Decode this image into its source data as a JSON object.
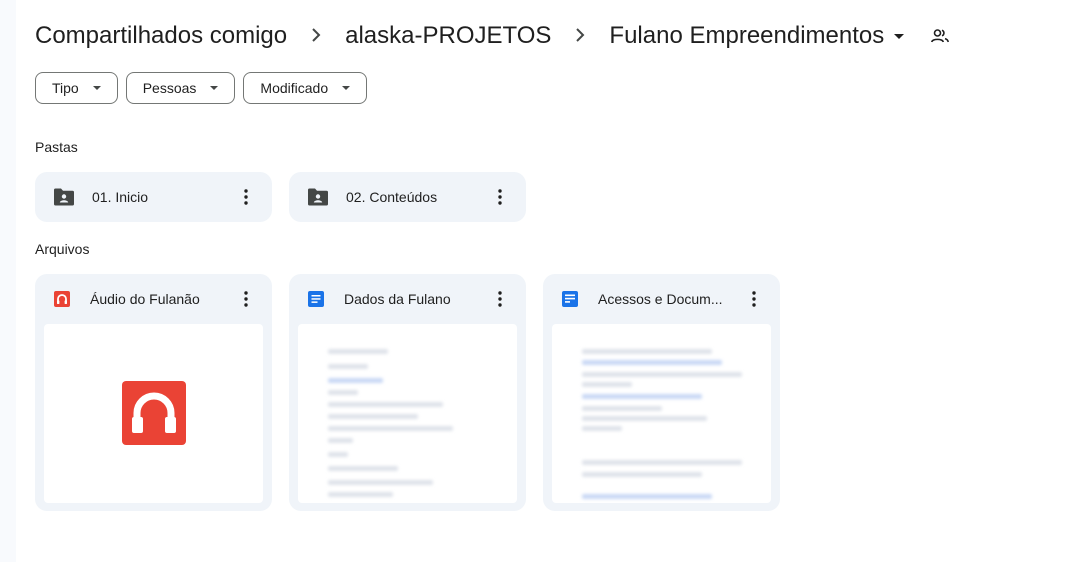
{
  "breadcrumb": {
    "items": [
      "Compartilhados comigo",
      "alaska-PROJETOS",
      "Fulano Empreendimentos"
    ],
    "separator": "›",
    "current_has_dropdown": true,
    "shared_icon": "people-icon"
  },
  "filters": [
    {
      "label": "Tipo"
    },
    {
      "label": "Pessoas"
    },
    {
      "label": "Modificado"
    }
  ],
  "sections": {
    "folders_label": "Pastas",
    "files_label": "Arquivos"
  },
  "folders": [
    {
      "name": "01. Inicio",
      "icon": "shared-folder-icon"
    },
    {
      "name": "02. Conteúdos",
      "icon": "shared-folder-icon"
    }
  ],
  "files": [
    {
      "name": "Áudio do Fulanão",
      "icon": "audio-file-icon",
      "icon_color": "#ea4335"
    },
    {
      "name": "Dados da Fulano",
      "icon": "google-docs-icon",
      "icon_color": "#1a73e8"
    },
    {
      "name": "Acessos e Docum...",
      "icon": "google-forms-doc-icon",
      "icon_color": "#1a73e8"
    }
  ],
  "colors": {
    "card_bg": "#f0f4f9",
    "text": "#1f1f1f",
    "audio_red": "#ea4335",
    "docs_blue": "#1a73e8"
  }
}
